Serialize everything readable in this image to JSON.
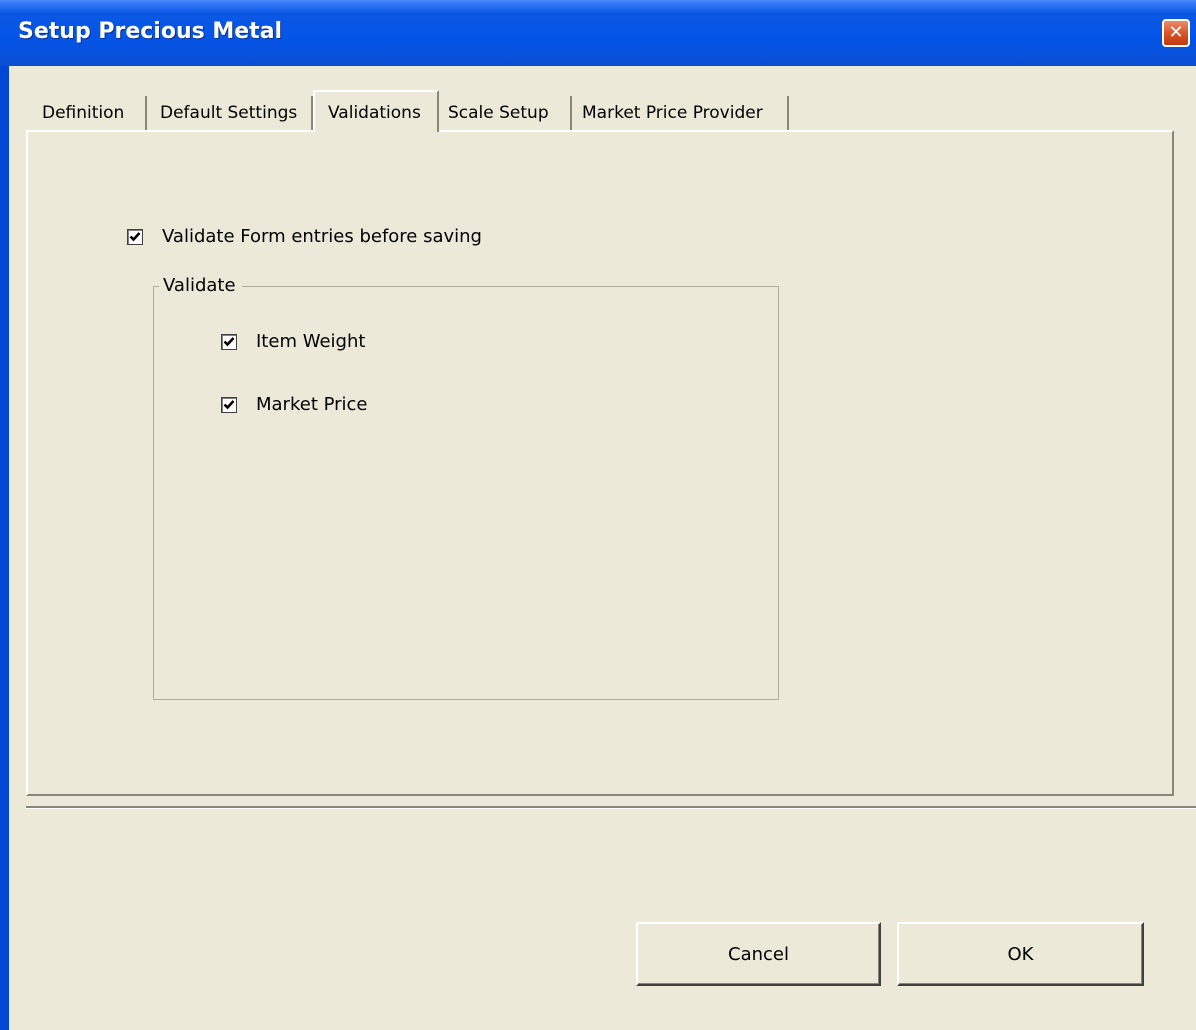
{
  "window": {
    "title": "Setup Precious Metal",
    "close_glyph": "✕"
  },
  "tabs": [
    {
      "label": "Definition",
      "active": false
    },
    {
      "label": "Default Settings",
      "active": false
    },
    {
      "label": "Validations",
      "active": true
    },
    {
      "label": "Scale Setup",
      "active": false
    },
    {
      "label": "Market Price Provider",
      "active": false
    }
  ],
  "validations": {
    "validate_before_saving": {
      "label": "Validate Form entries before saving",
      "checked": true
    },
    "group_label": "Validate",
    "item_weight": {
      "label": "Item Weight",
      "checked": true
    },
    "market_price": {
      "label": "Market Price",
      "checked": true
    }
  },
  "buttons": {
    "cancel": "Cancel",
    "ok": "OK"
  },
  "colors": {
    "titlebar": "#0454e8",
    "window_bg": "#ece9d8",
    "close_button": "#d54c20"
  }
}
